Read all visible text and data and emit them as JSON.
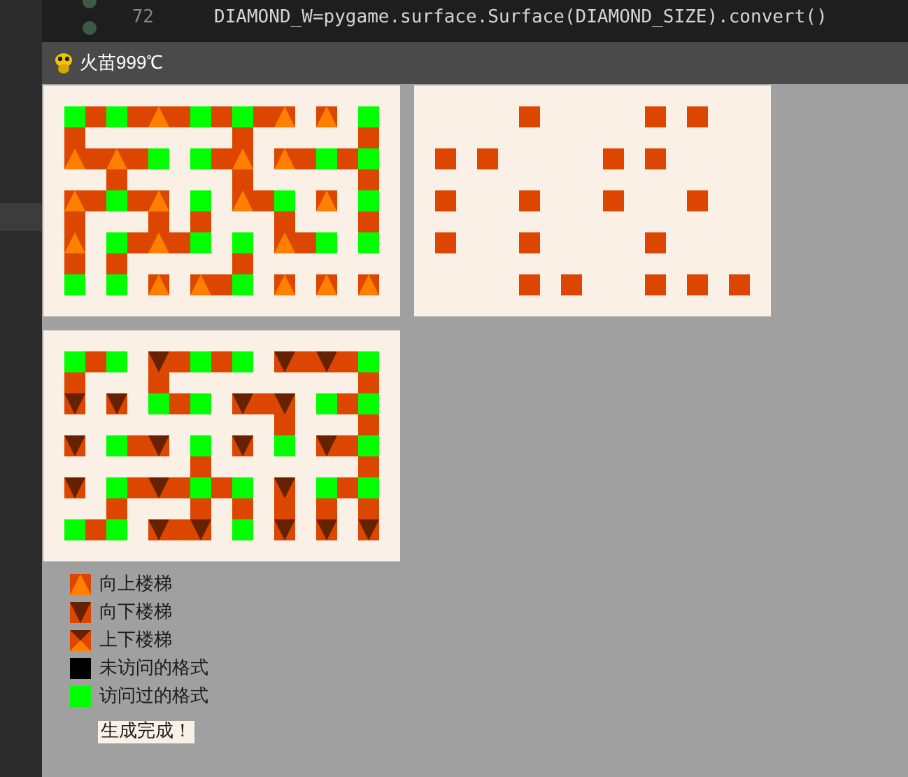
{
  "editor": {
    "lines": [
      {
        "number": "72",
        "code": "DIAMOND_W=pygame.surface.Surface(DIAMOND_SIZE).convert()"
      }
    ]
  },
  "window": {
    "title": "火苗999℃"
  },
  "mazes": [
    {
      "rows": [
        [
          {
            "kind": "visited"
          },
          {
            "kind": "path"
          },
          {
            "kind": "visited"
          },
          {
            "kind": "path"
          },
          {
            "kind": "up"
          },
          {
            "kind": "path"
          },
          {
            "kind": "visited"
          },
          {
            "kind": "path"
          },
          {
            "kind": "visited"
          },
          {
            "kind": "path"
          },
          {
            "kind": "up"
          },
          {
            "kind": "empty"
          },
          {
            "kind": "up"
          },
          {
            "kind": "empty"
          },
          {
            "kind": "visited"
          }
        ],
        [
          {
            "kind": "path"
          },
          {
            "kind": "empty"
          },
          {
            "kind": "empty"
          },
          {
            "kind": "empty"
          },
          {
            "kind": "empty"
          },
          {
            "kind": "empty"
          },
          {
            "kind": "empty"
          },
          {
            "kind": "empty"
          },
          {
            "kind": "path"
          },
          {
            "kind": "empty"
          },
          {
            "kind": "empty"
          },
          {
            "kind": "empty"
          },
          {
            "kind": "empty"
          },
          {
            "kind": "empty"
          },
          {
            "kind": "path"
          }
        ],
        [
          {
            "kind": "up"
          },
          {
            "kind": "path"
          },
          {
            "kind": "up"
          },
          {
            "kind": "path"
          },
          {
            "kind": "visited"
          },
          {
            "kind": "empty"
          },
          {
            "kind": "visited"
          },
          {
            "kind": "path"
          },
          {
            "kind": "up"
          },
          {
            "kind": "empty"
          },
          {
            "kind": "up"
          },
          {
            "kind": "path"
          },
          {
            "kind": "visited"
          },
          {
            "kind": "path"
          },
          {
            "kind": "visited"
          }
        ],
        [
          {
            "kind": "empty"
          },
          {
            "kind": "empty"
          },
          {
            "kind": "path"
          },
          {
            "kind": "empty"
          },
          {
            "kind": "empty"
          },
          {
            "kind": "empty"
          },
          {
            "kind": "empty"
          },
          {
            "kind": "empty"
          },
          {
            "kind": "path"
          },
          {
            "kind": "empty"
          },
          {
            "kind": "empty"
          },
          {
            "kind": "empty"
          },
          {
            "kind": "empty"
          },
          {
            "kind": "empty"
          },
          {
            "kind": "path"
          }
        ],
        [
          {
            "kind": "up"
          },
          {
            "kind": "path"
          },
          {
            "kind": "visited"
          },
          {
            "kind": "path"
          },
          {
            "kind": "up"
          },
          {
            "kind": "empty"
          },
          {
            "kind": "visited"
          },
          {
            "kind": "empty"
          },
          {
            "kind": "up"
          },
          {
            "kind": "path"
          },
          {
            "kind": "visited"
          },
          {
            "kind": "empty"
          },
          {
            "kind": "up"
          },
          {
            "kind": "empty"
          },
          {
            "kind": "visited"
          }
        ],
        [
          {
            "kind": "path"
          },
          {
            "kind": "empty"
          },
          {
            "kind": "empty"
          },
          {
            "kind": "empty"
          },
          {
            "kind": "path"
          },
          {
            "kind": "empty"
          },
          {
            "kind": "path"
          },
          {
            "kind": "empty"
          },
          {
            "kind": "empty"
          },
          {
            "kind": "empty"
          },
          {
            "kind": "path"
          },
          {
            "kind": "empty"
          },
          {
            "kind": "empty"
          },
          {
            "kind": "empty"
          },
          {
            "kind": "path"
          }
        ],
        [
          {
            "kind": "up"
          },
          {
            "kind": "empty"
          },
          {
            "kind": "visited"
          },
          {
            "kind": "path"
          },
          {
            "kind": "up"
          },
          {
            "kind": "path"
          },
          {
            "kind": "visited"
          },
          {
            "kind": "empty"
          },
          {
            "kind": "visited"
          },
          {
            "kind": "empty"
          },
          {
            "kind": "up"
          },
          {
            "kind": "path"
          },
          {
            "kind": "visited"
          },
          {
            "kind": "empty"
          },
          {
            "kind": "visited"
          }
        ],
        [
          {
            "kind": "path"
          },
          {
            "kind": "empty"
          },
          {
            "kind": "path"
          },
          {
            "kind": "empty"
          },
          {
            "kind": "empty"
          },
          {
            "kind": "empty"
          },
          {
            "kind": "empty"
          },
          {
            "kind": "empty"
          },
          {
            "kind": "path"
          },
          {
            "kind": "empty"
          },
          {
            "kind": "empty"
          },
          {
            "kind": "empty"
          },
          {
            "kind": "empty"
          },
          {
            "kind": "empty"
          },
          {
            "kind": "empty"
          }
        ],
        [
          {
            "kind": "visited"
          },
          {
            "kind": "empty"
          },
          {
            "kind": "visited"
          },
          {
            "kind": "empty"
          },
          {
            "kind": "up"
          },
          {
            "kind": "empty"
          },
          {
            "kind": "up"
          },
          {
            "kind": "path"
          },
          {
            "kind": "visited"
          },
          {
            "kind": "empty"
          },
          {
            "kind": "up"
          },
          {
            "kind": "empty"
          },
          {
            "kind": "up"
          },
          {
            "kind": "empty"
          },
          {
            "kind": "up"
          }
        ]
      ]
    },
    {
      "rows": [
        [
          {
            "kind": "empty"
          },
          {
            "kind": "empty"
          },
          {
            "kind": "empty"
          },
          {
            "kind": "empty"
          },
          {
            "kind": "path"
          },
          {
            "kind": "empty"
          },
          {
            "kind": "empty"
          },
          {
            "kind": "empty"
          },
          {
            "kind": "empty"
          },
          {
            "kind": "empty"
          },
          {
            "kind": "path"
          },
          {
            "kind": "empty"
          },
          {
            "kind": "path"
          },
          {
            "kind": "empty"
          },
          {
            "kind": "empty"
          }
        ],
        [
          {
            "kind": "empty"
          },
          {
            "kind": "empty"
          },
          {
            "kind": "empty"
          },
          {
            "kind": "empty"
          },
          {
            "kind": "empty"
          },
          {
            "kind": "empty"
          },
          {
            "kind": "empty"
          },
          {
            "kind": "empty"
          },
          {
            "kind": "empty"
          },
          {
            "kind": "empty"
          },
          {
            "kind": "empty"
          },
          {
            "kind": "empty"
          },
          {
            "kind": "empty"
          },
          {
            "kind": "empty"
          },
          {
            "kind": "empty"
          }
        ],
        [
          {
            "kind": "path"
          },
          {
            "kind": "empty"
          },
          {
            "kind": "path"
          },
          {
            "kind": "empty"
          },
          {
            "kind": "empty"
          },
          {
            "kind": "empty"
          },
          {
            "kind": "empty"
          },
          {
            "kind": "empty"
          },
          {
            "kind": "path"
          },
          {
            "kind": "empty"
          },
          {
            "kind": "path"
          },
          {
            "kind": "empty"
          },
          {
            "kind": "empty"
          },
          {
            "kind": "empty"
          },
          {
            "kind": "empty"
          }
        ],
        [
          {
            "kind": "empty"
          },
          {
            "kind": "empty"
          },
          {
            "kind": "empty"
          },
          {
            "kind": "empty"
          },
          {
            "kind": "empty"
          },
          {
            "kind": "empty"
          },
          {
            "kind": "empty"
          },
          {
            "kind": "empty"
          },
          {
            "kind": "empty"
          },
          {
            "kind": "empty"
          },
          {
            "kind": "empty"
          },
          {
            "kind": "empty"
          },
          {
            "kind": "empty"
          },
          {
            "kind": "empty"
          },
          {
            "kind": "empty"
          }
        ],
        [
          {
            "kind": "path"
          },
          {
            "kind": "empty"
          },
          {
            "kind": "empty"
          },
          {
            "kind": "empty"
          },
          {
            "kind": "path"
          },
          {
            "kind": "empty"
          },
          {
            "kind": "empty"
          },
          {
            "kind": "empty"
          },
          {
            "kind": "path"
          },
          {
            "kind": "empty"
          },
          {
            "kind": "empty"
          },
          {
            "kind": "empty"
          },
          {
            "kind": "path"
          },
          {
            "kind": "empty"
          },
          {
            "kind": "empty"
          }
        ],
        [
          {
            "kind": "empty"
          },
          {
            "kind": "empty"
          },
          {
            "kind": "empty"
          },
          {
            "kind": "empty"
          },
          {
            "kind": "empty"
          },
          {
            "kind": "empty"
          },
          {
            "kind": "empty"
          },
          {
            "kind": "empty"
          },
          {
            "kind": "empty"
          },
          {
            "kind": "empty"
          },
          {
            "kind": "empty"
          },
          {
            "kind": "empty"
          },
          {
            "kind": "empty"
          },
          {
            "kind": "empty"
          },
          {
            "kind": "empty"
          }
        ],
        [
          {
            "kind": "path"
          },
          {
            "kind": "empty"
          },
          {
            "kind": "empty"
          },
          {
            "kind": "empty"
          },
          {
            "kind": "path"
          },
          {
            "kind": "empty"
          },
          {
            "kind": "empty"
          },
          {
            "kind": "empty"
          },
          {
            "kind": "empty"
          },
          {
            "kind": "empty"
          },
          {
            "kind": "path"
          },
          {
            "kind": "empty"
          },
          {
            "kind": "empty"
          },
          {
            "kind": "empty"
          },
          {
            "kind": "empty"
          }
        ],
        [
          {
            "kind": "empty"
          },
          {
            "kind": "empty"
          },
          {
            "kind": "empty"
          },
          {
            "kind": "empty"
          },
          {
            "kind": "empty"
          },
          {
            "kind": "empty"
          },
          {
            "kind": "empty"
          },
          {
            "kind": "empty"
          },
          {
            "kind": "empty"
          },
          {
            "kind": "empty"
          },
          {
            "kind": "empty"
          },
          {
            "kind": "empty"
          },
          {
            "kind": "empty"
          },
          {
            "kind": "empty"
          },
          {
            "kind": "empty"
          }
        ],
        [
          {
            "kind": "empty"
          },
          {
            "kind": "empty"
          },
          {
            "kind": "empty"
          },
          {
            "kind": "empty"
          },
          {
            "kind": "path"
          },
          {
            "kind": "empty"
          },
          {
            "kind": "path"
          },
          {
            "kind": "empty"
          },
          {
            "kind": "empty"
          },
          {
            "kind": "empty"
          },
          {
            "kind": "path"
          },
          {
            "kind": "empty"
          },
          {
            "kind": "path"
          },
          {
            "kind": "empty"
          },
          {
            "kind": "path"
          }
        ]
      ]
    },
    {
      "rows": [
        [
          {
            "kind": "visited"
          },
          {
            "kind": "path"
          },
          {
            "kind": "visited"
          },
          {
            "kind": "empty"
          },
          {
            "kind": "down"
          },
          {
            "kind": "path"
          },
          {
            "kind": "visited"
          },
          {
            "kind": "path"
          },
          {
            "kind": "visited"
          },
          {
            "kind": "empty"
          },
          {
            "kind": "down"
          },
          {
            "kind": "path"
          },
          {
            "kind": "down"
          },
          {
            "kind": "path"
          },
          {
            "kind": "visited"
          }
        ],
        [
          {
            "kind": "path"
          },
          {
            "kind": "empty"
          },
          {
            "kind": "empty"
          },
          {
            "kind": "empty"
          },
          {
            "kind": "path"
          },
          {
            "kind": "empty"
          },
          {
            "kind": "empty"
          },
          {
            "kind": "empty"
          },
          {
            "kind": "empty"
          },
          {
            "kind": "empty"
          },
          {
            "kind": "empty"
          },
          {
            "kind": "empty"
          },
          {
            "kind": "empty"
          },
          {
            "kind": "empty"
          },
          {
            "kind": "path"
          }
        ],
        [
          {
            "kind": "down"
          },
          {
            "kind": "empty"
          },
          {
            "kind": "down"
          },
          {
            "kind": "empty"
          },
          {
            "kind": "visited"
          },
          {
            "kind": "path"
          },
          {
            "kind": "visited"
          },
          {
            "kind": "empty"
          },
          {
            "kind": "down"
          },
          {
            "kind": "path"
          },
          {
            "kind": "down"
          },
          {
            "kind": "empty"
          },
          {
            "kind": "visited"
          },
          {
            "kind": "path"
          },
          {
            "kind": "visited"
          }
        ],
        [
          {
            "kind": "empty"
          },
          {
            "kind": "empty"
          },
          {
            "kind": "empty"
          },
          {
            "kind": "empty"
          },
          {
            "kind": "empty"
          },
          {
            "kind": "empty"
          },
          {
            "kind": "empty"
          },
          {
            "kind": "empty"
          },
          {
            "kind": "empty"
          },
          {
            "kind": "empty"
          },
          {
            "kind": "path"
          },
          {
            "kind": "empty"
          },
          {
            "kind": "empty"
          },
          {
            "kind": "empty"
          },
          {
            "kind": "path"
          }
        ],
        [
          {
            "kind": "down"
          },
          {
            "kind": "empty"
          },
          {
            "kind": "visited"
          },
          {
            "kind": "path"
          },
          {
            "kind": "down"
          },
          {
            "kind": "empty"
          },
          {
            "kind": "visited"
          },
          {
            "kind": "empty"
          },
          {
            "kind": "down"
          },
          {
            "kind": "empty"
          },
          {
            "kind": "visited"
          },
          {
            "kind": "empty"
          },
          {
            "kind": "down"
          },
          {
            "kind": "path"
          },
          {
            "kind": "visited"
          }
        ],
        [
          {
            "kind": "empty"
          },
          {
            "kind": "empty"
          },
          {
            "kind": "empty"
          },
          {
            "kind": "empty"
          },
          {
            "kind": "empty"
          },
          {
            "kind": "empty"
          },
          {
            "kind": "path"
          },
          {
            "kind": "empty"
          },
          {
            "kind": "empty"
          },
          {
            "kind": "empty"
          },
          {
            "kind": "empty"
          },
          {
            "kind": "empty"
          },
          {
            "kind": "empty"
          },
          {
            "kind": "empty"
          },
          {
            "kind": "path"
          }
        ],
        [
          {
            "kind": "down"
          },
          {
            "kind": "empty"
          },
          {
            "kind": "visited"
          },
          {
            "kind": "path"
          },
          {
            "kind": "down"
          },
          {
            "kind": "path"
          },
          {
            "kind": "visited"
          },
          {
            "kind": "path"
          },
          {
            "kind": "visited"
          },
          {
            "kind": "empty"
          },
          {
            "kind": "down"
          },
          {
            "kind": "empty"
          },
          {
            "kind": "visited"
          },
          {
            "kind": "path"
          },
          {
            "kind": "visited"
          }
        ],
        [
          {
            "kind": "empty"
          },
          {
            "kind": "empty"
          },
          {
            "kind": "path"
          },
          {
            "kind": "empty"
          },
          {
            "kind": "empty"
          },
          {
            "kind": "empty"
          },
          {
            "kind": "path"
          },
          {
            "kind": "empty"
          },
          {
            "kind": "path"
          },
          {
            "kind": "empty"
          },
          {
            "kind": "path"
          },
          {
            "kind": "empty"
          },
          {
            "kind": "path"
          },
          {
            "kind": "empty"
          },
          {
            "kind": "path"
          }
        ],
        [
          {
            "kind": "visited"
          },
          {
            "kind": "path"
          },
          {
            "kind": "visited"
          },
          {
            "kind": "empty"
          },
          {
            "kind": "down"
          },
          {
            "kind": "path"
          },
          {
            "kind": "down"
          },
          {
            "kind": "empty"
          },
          {
            "kind": "visited"
          },
          {
            "kind": "empty"
          },
          {
            "kind": "down"
          },
          {
            "kind": "empty"
          },
          {
            "kind": "down"
          },
          {
            "kind": "empty"
          },
          {
            "kind": "down"
          }
        ]
      ]
    }
  ],
  "legend": [
    {
      "kind": "up",
      "label": "向上楼梯"
    },
    {
      "kind": "down",
      "label": "向下楼梯"
    },
    {
      "kind": "both",
      "label": "上下楼梯"
    },
    {
      "kind": "unvisited",
      "label": "未访问的格式"
    },
    {
      "kind": "visited",
      "label": "访问过的格式"
    }
  ],
  "status": "生成完成！"
}
